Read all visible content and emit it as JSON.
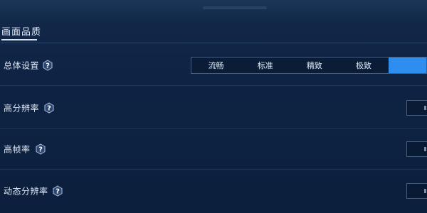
{
  "header": {
    "title": "画面品质"
  },
  "settings": {
    "overall": {
      "label": "总体设置",
      "help_icon": "question-hex-icon",
      "options": [
        "流畅",
        "标准",
        "精致",
        "极致"
      ],
      "selected_option_partially_visible": true
    },
    "high_resolution": {
      "label": "高分辨率",
      "help_icon": "question-hex-icon"
    },
    "high_frame_rate": {
      "label": "高帧率",
      "help_icon": "question-hex-icon"
    },
    "dynamic_resolution": {
      "label": "动态分辨率",
      "help_icon": "question-hex-icon"
    }
  },
  "colors": {
    "background": "#0f2444",
    "accent": "#2e8ef0",
    "text": "#dfe9f7"
  }
}
